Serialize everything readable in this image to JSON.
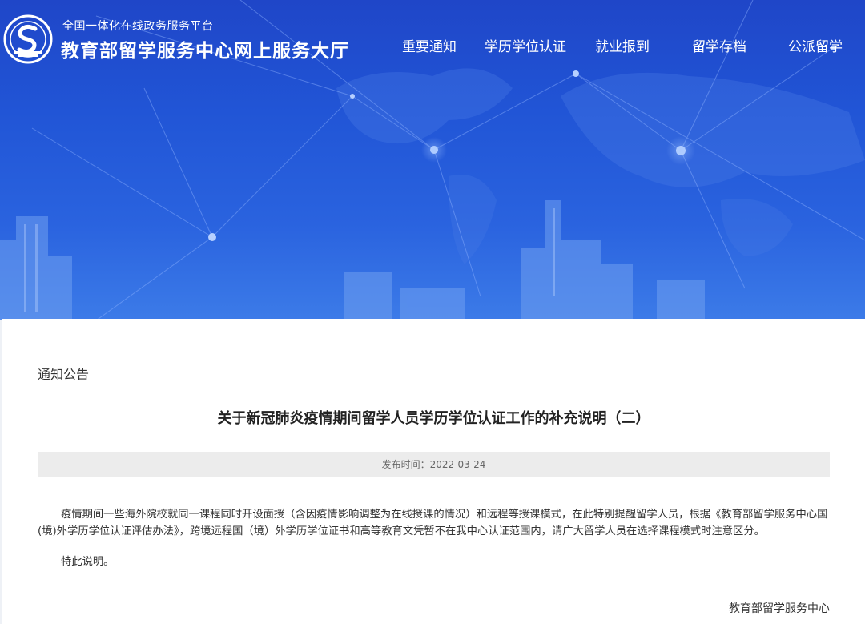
{
  "header": {
    "platform_subtitle": "全国一体化在线政务服务平台",
    "platform_title": "教育部留学服务中心网上服务大厅",
    "logo_icon": "cscse-logo-icon"
  },
  "nav": {
    "items": [
      {
        "label": "重要通知"
      },
      {
        "label": "学历学位认证"
      },
      {
        "label": "就业报到"
      },
      {
        "label": "留学存档"
      },
      {
        "label": "公派留学"
      }
    ]
  },
  "main": {
    "section_label": "通知公告",
    "article_title": "关于新冠肺炎疫情期间留学人员学历学位认证工作的补充说明（二）",
    "publish_label": "发布时间：",
    "publish_date": "2022-03-24",
    "paragraph1": "疫情期间一些海外院校就同一课程同时开设面授（含因疫情影响调整为在线授课的情况）和远程等授课模式，在此特别提醒留学人员，根据《教育部留学服务中心国(境)外学历学位认证评估办法》，跨境远程国（境）外学历学位证书和高等教育文凭暂不在我中心认证范围内，请广大留学人员在选择课程模式时注意区分。",
    "paragraph2": "特此说明。",
    "signature": "教育部留学服务中心"
  },
  "colors": {
    "hero_blue": "#2155d6",
    "text_dark": "#333333",
    "meta_bg": "#ececec"
  }
}
